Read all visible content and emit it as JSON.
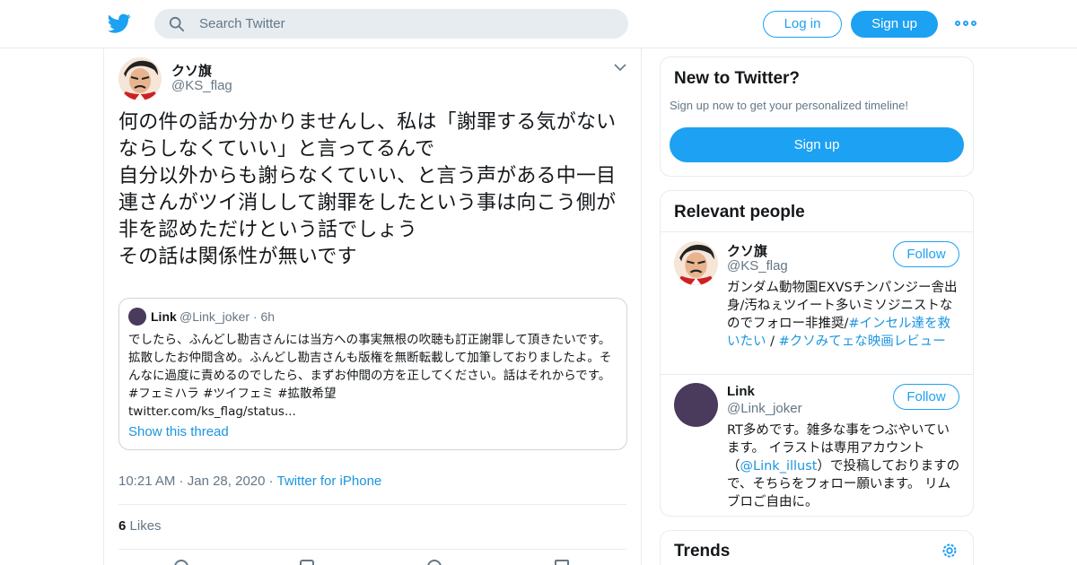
{
  "header": {
    "search_placeholder": "Search Twitter",
    "login_label": "Log in",
    "signup_label": "Sign up",
    "logo_icon": "twitter-bird-icon",
    "more_icon": "more-dots-icon",
    "accent": "#1da1f2"
  },
  "tweet": {
    "author_name": "クソ旗",
    "author_handle": "@KS_flag",
    "text": "何の件の話か分かりませんし、私は「謝罪する気がないならしなくていい」と言ってるんで\n自分以外からも謝らなくていい、と言う声がある中一目連さんがツイ消しして謝罪をしたという事は向こう側が非を認めただけという話でしょう\nその話は関係性が無いです",
    "time": "10:21 AM",
    "date": "Jan 28, 2020",
    "source": "Twitter for iPhone",
    "likes_count": "6",
    "likes_label": "Likes",
    "quote": {
      "author_name": "Link",
      "author_handle": "@Link_joker",
      "age": "6h",
      "text": "でしたら、ふんどし勘吉さんには当方への事実無根の吹聴も訂正謝罪して頂きたいです。拡散したお仲間含め。ふんどし勘吉さんも版権を無断転載して加筆しておりましたよ。そんなに過度に責めるのでしたら、まずお仲間の方を正してください。話はそれからです。 #フェミハラ #ツイフェミ #拡散希望\ntwitter.com/ks_flag/status...",
      "show_thread": "Show this thread"
    }
  },
  "sidebar": {
    "new_title": "New to Twitter?",
    "new_sub": "Sign up now to get your personalized timeline!",
    "new_signup": "Sign up",
    "relevant_title": "Relevant people",
    "people": [
      {
        "name": "クソ旗",
        "handle": "@KS_flag",
        "follow": "Follow",
        "bio_plain": "ガンダム動物園EXVSチンパンジー舎出身/汚ねぇツイート多いミソジニストなのでフォロー非推奨/",
        "bio_link1": "#インセル達を救いたい",
        "bio_sep": " / ",
        "bio_link2": "#クソみてェな映画レビュー"
      },
      {
        "name": "Link",
        "handle": "@Link_joker",
        "follow": "Follow",
        "bio_pre": "RT多めです。雑多な事をつぶやいています。 イラストは専用アカウント（",
        "bio_link": "@Link_illust",
        "bio_post": "）で投稿しておりますので、そちらをフォロー願います。 リムブロご自由に。"
      }
    ],
    "trends_title": "Trends"
  }
}
